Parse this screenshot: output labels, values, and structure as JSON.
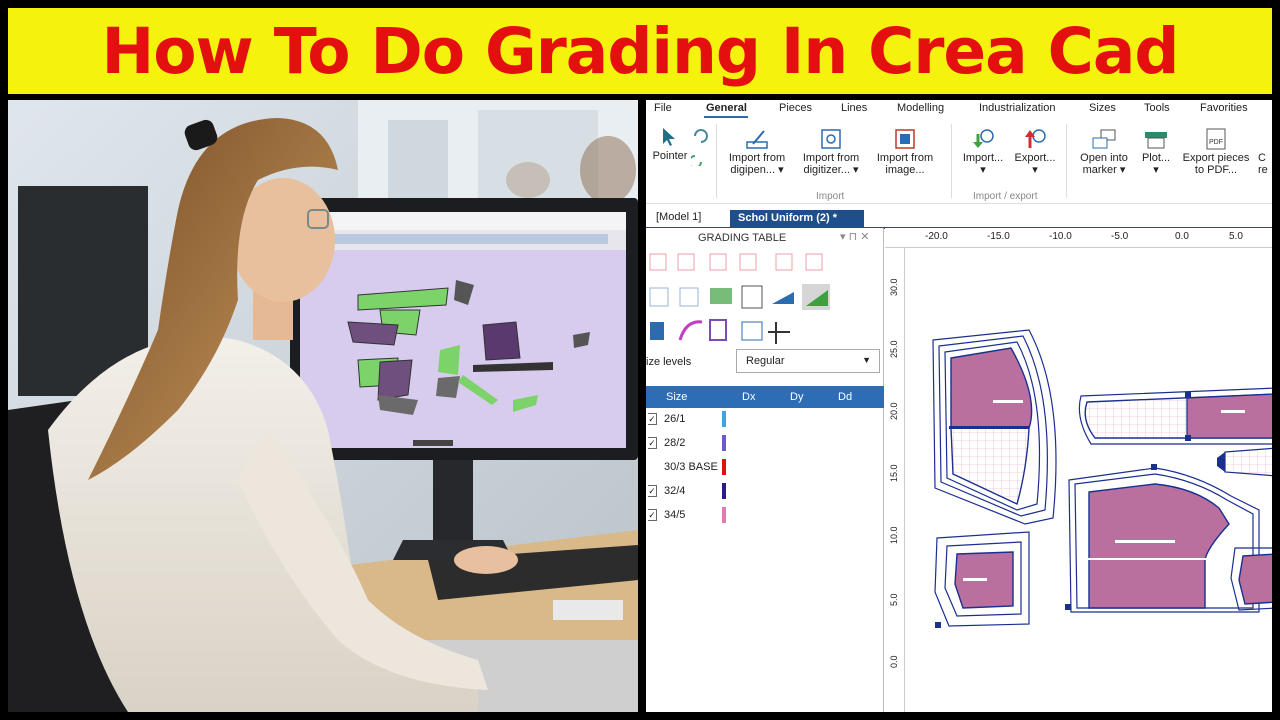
{
  "banner": {
    "title": "How To Do Grading In Crea Cad"
  },
  "app": {
    "menu": [
      {
        "label": "File"
      },
      {
        "label": "General",
        "active": true
      },
      {
        "label": "Pieces"
      },
      {
        "label": "Lines"
      },
      {
        "label": "Modelling"
      },
      {
        "label": "Industrialization"
      },
      {
        "label": "Sizes"
      },
      {
        "label": "Tools"
      },
      {
        "label": "Favorities"
      }
    ],
    "ribbon": {
      "pointer": "Pointer",
      "import_digipen": "Import from\ndigipen... ▾",
      "import_digitizer": "Import from\ndigitizer... ▾",
      "import_image": "Import from\nimage...",
      "import_label": "Import",
      "import_btn": "Import...\n▾",
      "export_btn": "Export...\n▾",
      "import_export_label": "Import / export",
      "open_marker": "Open into\nmarker ▾",
      "plot": "Plot...\n▾",
      "export_pdf": "Export pieces\nto PDF...",
      "pdf_icon_text": "PDF",
      "cut_more": "C\nre"
    },
    "tabs": {
      "model": "[Model 1]",
      "school": "Schol Uniform (2) *"
    },
    "grading": {
      "title": "GRADING TABLE",
      "controls": "▾ ⊓ ✕",
      "size_levels_label": "ize levels",
      "size_levels_value": "Regular",
      "columns": [
        "Size",
        "Dx",
        "Dy",
        "Dd"
      ],
      "rows": [
        {
          "size": "26/1",
          "checked": true,
          "color": "#3aa7e0"
        },
        {
          "size": "28/2",
          "checked": true,
          "color": "#6a5acd"
        },
        {
          "size": "30/3  BASE",
          "checked": false,
          "color": "#e01010"
        },
        {
          "size": "32/4",
          "checked": true,
          "color": "#2a1a8a"
        },
        {
          "size": "34/5",
          "checked": true,
          "color": "#e07ab0"
        }
      ],
      "check_mark": "✓"
    },
    "ruler": {
      "top": [
        "-20.0",
        "-15.0",
        "-10.0",
        "-5.0",
        "0.0",
        "5.0"
      ],
      "left": [
        "30.0",
        "25.0",
        "20.0",
        "15.0",
        "10.0",
        "5.0",
        "0.0"
      ]
    },
    "colors": {
      "accent": "#1f4e8c",
      "header": "#2d6db5",
      "piece": "#b9709e",
      "outline": "#1b2f8f"
    }
  }
}
